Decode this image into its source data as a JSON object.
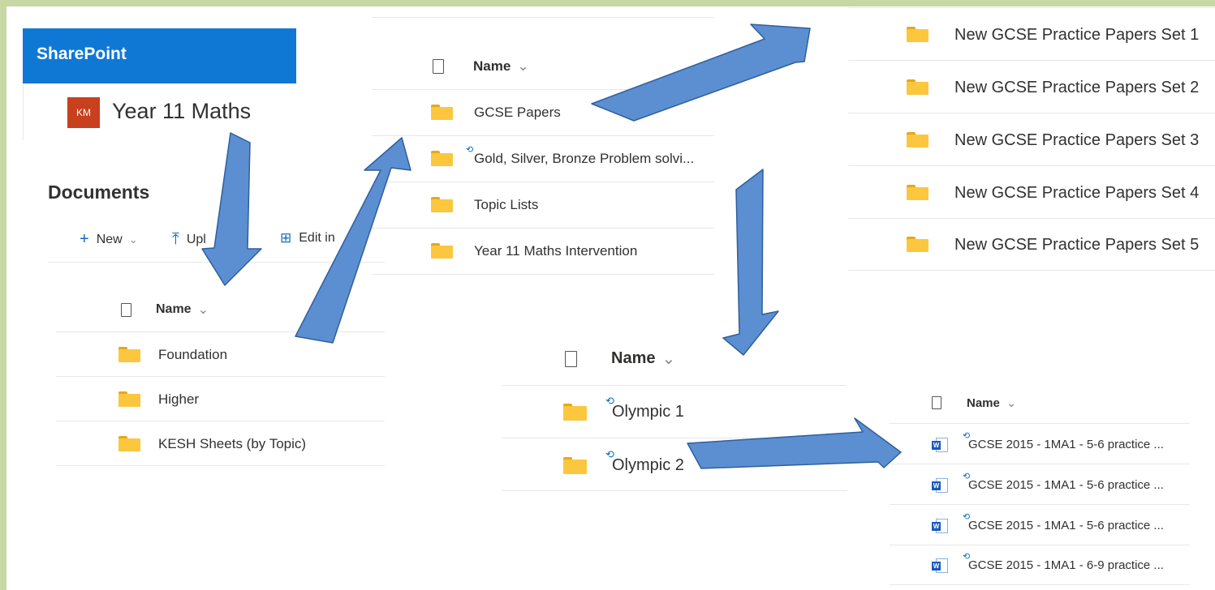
{
  "sharepoint": {
    "title": "SharePoint"
  },
  "site": {
    "initials": "KM",
    "name": "Year 11 Maths"
  },
  "documents": {
    "title": "Documents",
    "commands": {
      "new": "New",
      "upload": "Upl",
      "edit": "Edit in"
    },
    "header": "Name",
    "folders": [
      "Foundation",
      "Higher",
      "KESH Sheets (by Topic)"
    ]
  },
  "panel_foundation": {
    "header": "Name",
    "folders": [
      "GCSE Papers",
      "Gold, Silver, Bronze Problem solvi...",
      "Topic Lists",
      "Year 11 Maths Intervention"
    ]
  },
  "panel_gcse": {
    "folders": [
      "New GCSE Practice Papers Set 1",
      "New GCSE Practice Papers Set 2",
      "New GCSE Practice Papers Set 3",
      "New GCSE Practice Papers Set 4",
      "New GCSE Practice Papers Set 5"
    ]
  },
  "panel_olympic": {
    "header": "Name",
    "folders": [
      "Olympic 1",
      "Olympic 2"
    ]
  },
  "panel_files": {
    "header": "Name",
    "files": [
      "GCSE 2015 - 1MA1 - 5-6 practice ...",
      "GCSE 2015 - 1MA1 - 5-6 practice ...",
      "GCSE 2015 - 1MA1 - 5-6 practice ...",
      "GCSE 2015 - 1MA1 - 6-9 practice ..."
    ]
  },
  "colors": {
    "accent": "#0f78d4",
    "arrow_fill": "#5b8fd1",
    "arrow_stroke": "#2f5f9c",
    "folder": "#fcc63e",
    "frame": "#c7d8a4",
    "site_badge": "#c8401d"
  }
}
